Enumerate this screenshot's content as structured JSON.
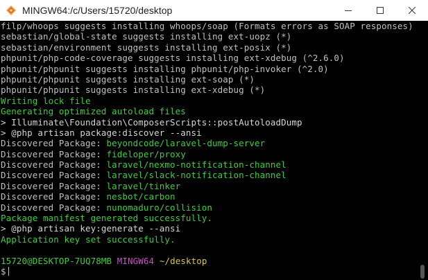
{
  "window": {
    "title": "MINGW64:/c/Users/15720/desktop",
    "minimize_label": "minimize",
    "maximize_label": "maximize",
    "close_label": "close"
  },
  "colors": {
    "background": "#000000",
    "text": "#c0c0c0",
    "green": "#3fcd3f",
    "yellow": "#d6c84a",
    "magenta": "#c850c8"
  },
  "terminal": {
    "lines": [
      [
        {
          "t": "filp/whoops suggests installing whoops/soap (Formats errors as SOAP responses)"
        }
      ],
      [
        {
          "t": "sebastian/global-state suggests installing ext-uopz (*)"
        }
      ],
      [
        {
          "t": "sebastian/environment suggests installing ext-posix (*)"
        }
      ],
      [
        {
          "t": "phpunit/php-code-coverage suggests installing ext-xdebug (^2.6.0)"
        }
      ],
      [
        {
          "t": "phpunit/phpunit suggests installing phpunit/php-invoker (^2.0)"
        }
      ],
      [
        {
          "t": "phpunit/phpunit suggests installing ext-soap (*)"
        }
      ],
      [
        {
          "t": "phpunit/phpunit suggests installing ext-xdebug (*)"
        }
      ],
      [
        {
          "t": "Writing lock file",
          "c": "green"
        }
      ],
      [
        {
          "t": "Generating optimized autoload files",
          "c": "green"
        }
      ],
      [
        {
          "t": "> Illuminate\\Foundation\\ComposerScripts::postAutoloadDump",
          "c": "white"
        }
      ],
      [
        {
          "t": "> @php artisan package:discover --ansi",
          "c": "white"
        }
      ],
      [
        {
          "t": "Discovered Package: "
        },
        {
          "t": "beyondcode/laravel-dump-server",
          "c": "green"
        }
      ],
      [
        {
          "t": "Discovered Package: "
        },
        {
          "t": "fideloper/proxy",
          "c": "green"
        }
      ],
      [
        {
          "t": "Discovered Package: "
        },
        {
          "t": "laravel/nexmo-notification-channel",
          "c": "green"
        }
      ],
      [
        {
          "t": "Discovered Package: "
        },
        {
          "t": "laravel/slack-notification-channel",
          "c": "green"
        }
      ],
      [
        {
          "t": "Discovered Package: "
        },
        {
          "t": "laravel/tinker",
          "c": "green"
        }
      ],
      [
        {
          "t": "Discovered Package: "
        },
        {
          "t": "nesbot/carbon",
          "c": "green"
        }
      ],
      [
        {
          "t": "Discovered Package: "
        },
        {
          "t": "nunomaduro/collision",
          "c": "green"
        }
      ],
      [
        {
          "t": "Package manifest generated successfully.",
          "c": "green"
        }
      ],
      [
        {
          "t": "> @php artisan key:generate --ansi",
          "c": "white"
        }
      ],
      [
        {
          "t": "Application key set successfully.",
          "c": "green"
        }
      ],
      [
        {
          "t": ""
        }
      ]
    ],
    "prompt": {
      "user_host": "15720@DESKTOP-7UQ78MB",
      "system": "MINGW64",
      "path": "~/desktop",
      "symbol": "$"
    }
  }
}
